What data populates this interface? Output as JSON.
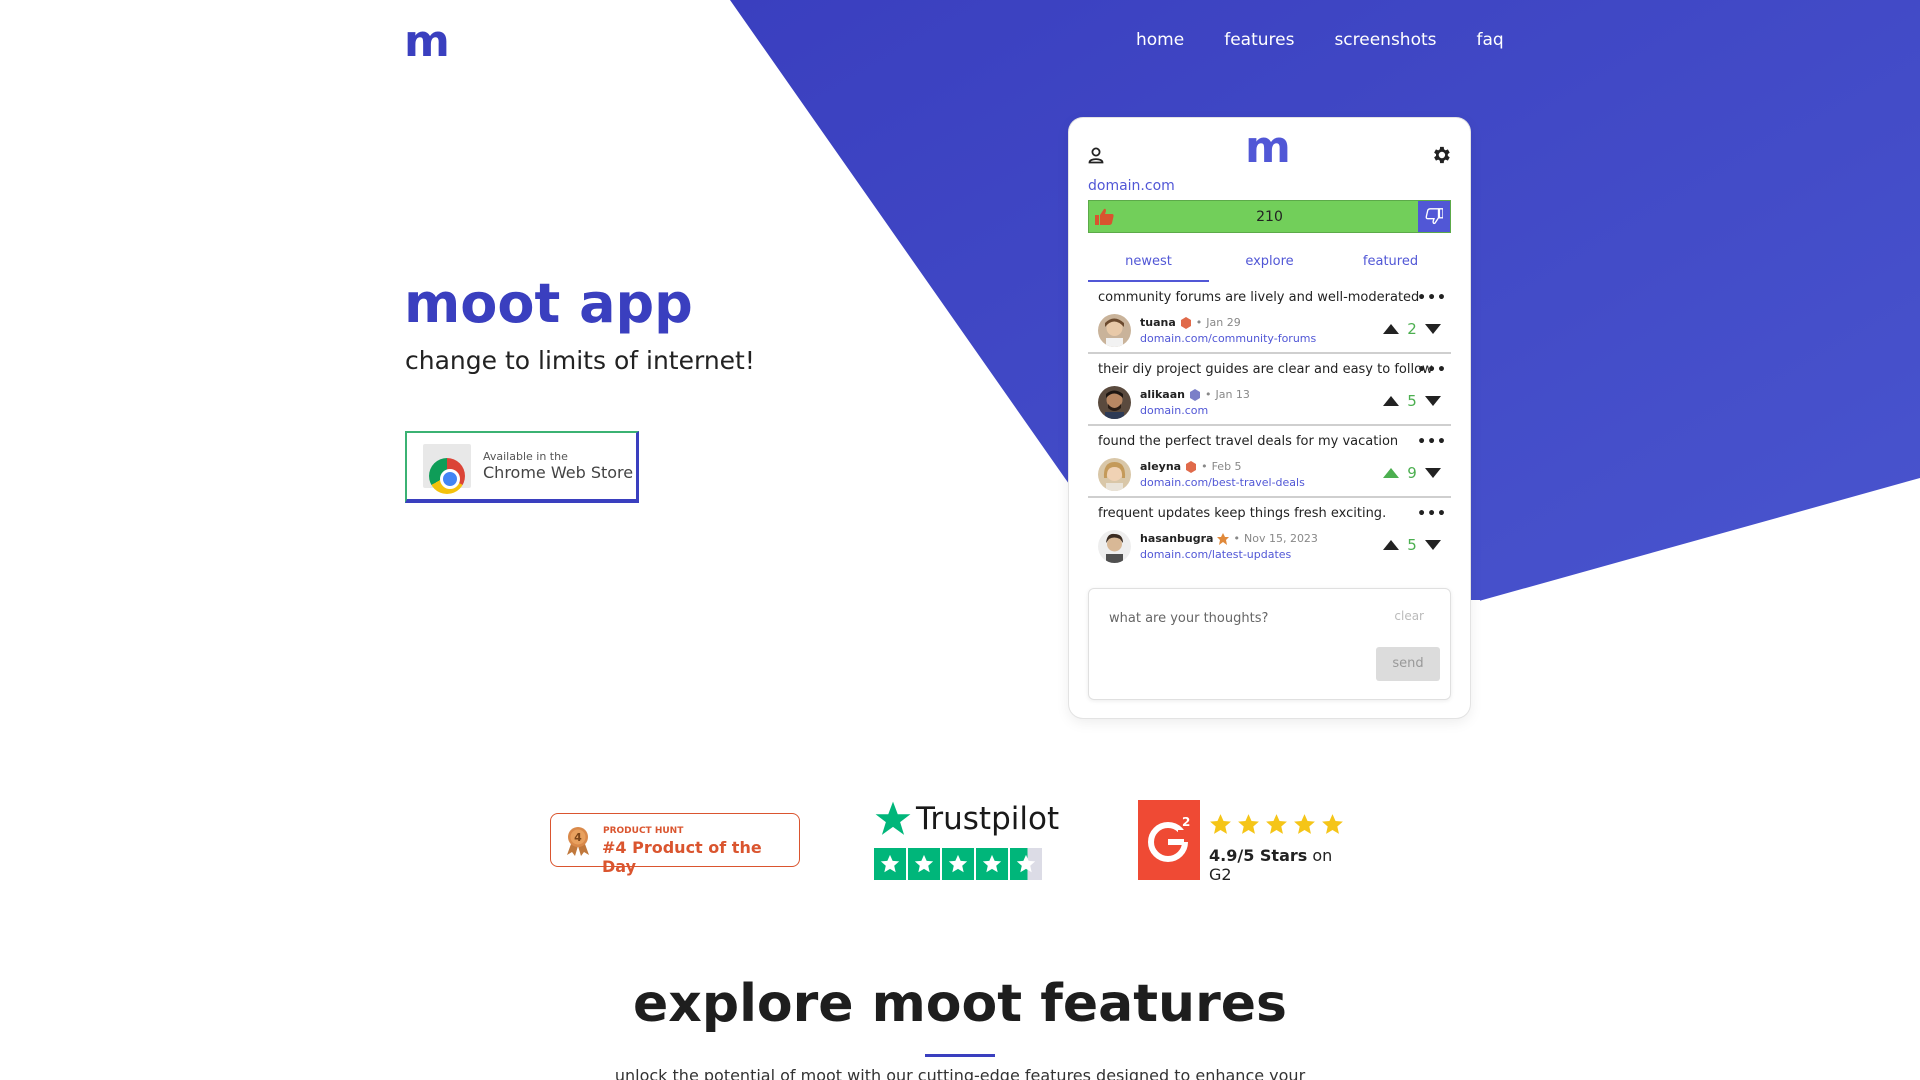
{
  "brand": {
    "logo": "m",
    "accent": "#3a3fbf",
    "panel_accent": "#5157d6",
    "upvote_green": "#72cf5a"
  },
  "nav": {
    "items": [
      "home",
      "features",
      "screenshots",
      "faq"
    ]
  },
  "hero": {
    "title": "moot app",
    "subtitle": "change to limits of internet!",
    "store_badge": {
      "small": "Available in the",
      "big": "Chrome Web Store"
    }
  },
  "panel": {
    "logo": "m",
    "domain": "domain.com",
    "score": "210",
    "tabs": [
      "newest",
      "explore",
      "featured"
    ],
    "active_tab": "newest",
    "posts": [
      {
        "text": "community forums are lively and well-moderated",
        "user": "tuana",
        "badge_color": "#e06a4a",
        "date": "Jan 29",
        "link": "domain.com/community-forums",
        "score": "2",
        "up_active": false
      },
      {
        "text": "their diy project guides are clear and easy to follow",
        "user": "alikaan",
        "badge_color": "#7b7fc8",
        "date": "Jan 13",
        "link": "domain.com",
        "score": "5",
        "up_active": false
      },
      {
        "text": "found the perfect travel deals for my vacation",
        "user": "aleyna",
        "badge_color": "#e06a4a",
        "date": "Feb 5",
        "link": "domain.com/best-travel-deals",
        "score": "9",
        "up_active": true
      },
      {
        "text": "frequent updates keep things fresh exciting.",
        "user": "hasanbugra",
        "badge_color": "#e0893a",
        "date": "Nov 15, 2023",
        "link": "domain.com/latest-updates",
        "score": "5",
        "up_active": false
      }
    ],
    "compose": {
      "placeholder": "what are your thoughts?",
      "clear": "clear",
      "send": "send"
    }
  },
  "badges": {
    "producthunt": {
      "small": "PRODUCT HUNT",
      "big": "#4 Product of the Day",
      "medal": "4"
    },
    "trustpilot": {
      "title": "Trustpilot",
      "stars": 4.5
    },
    "g2": {
      "rating": "4.9/5 Stars",
      "suffix": " on G2",
      "stars": 5
    }
  },
  "features": {
    "title": "explore moot features",
    "subtitle": "unlock the potential of moot with our cutting-edge features designed to enhance your"
  }
}
